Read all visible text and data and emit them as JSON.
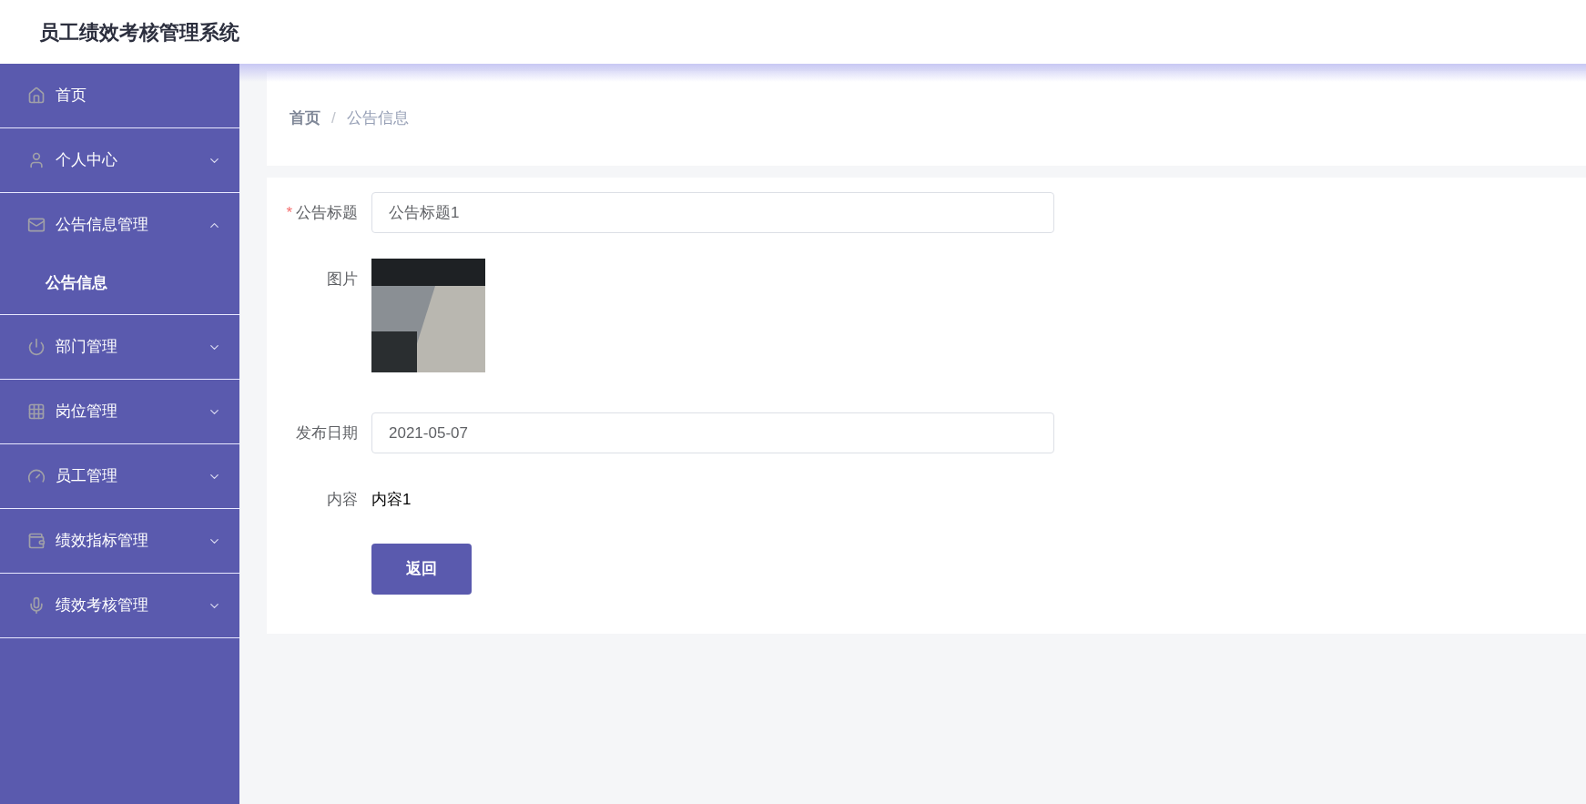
{
  "header": {
    "title": "员工绩效考核管理系统"
  },
  "sidebar": {
    "items": [
      {
        "label": "首页"
      },
      {
        "label": "个人中心",
        "expanded": false
      },
      {
        "label": "公告信息管理",
        "expanded": true,
        "children": [
          {
            "label": "公告信息",
            "selected": true
          }
        ]
      },
      {
        "label": "部门管理",
        "expanded": false
      },
      {
        "label": "岗位管理",
        "expanded": false
      },
      {
        "label": "员工管理",
        "expanded": false
      },
      {
        "label": "绩效指标管理",
        "expanded": false
      },
      {
        "label": "绩效考核管理",
        "expanded": false
      }
    ]
  },
  "breadcrumb": {
    "items": [
      "首页",
      "公告信息"
    ],
    "separator": "/"
  },
  "form": {
    "required_mark": "*",
    "fields": [
      {
        "kind": "input",
        "label": "公告标题",
        "required": true,
        "value": "公告标题1"
      },
      {
        "kind": "image",
        "label": "图片",
        "required": false
      },
      {
        "kind": "input",
        "label": "发布日期",
        "required": false,
        "value": "2021-05-07"
      },
      {
        "kind": "text",
        "label": "内容",
        "required": false,
        "value": "内容1"
      }
    ],
    "buttons": [
      "返回"
    ]
  }
}
